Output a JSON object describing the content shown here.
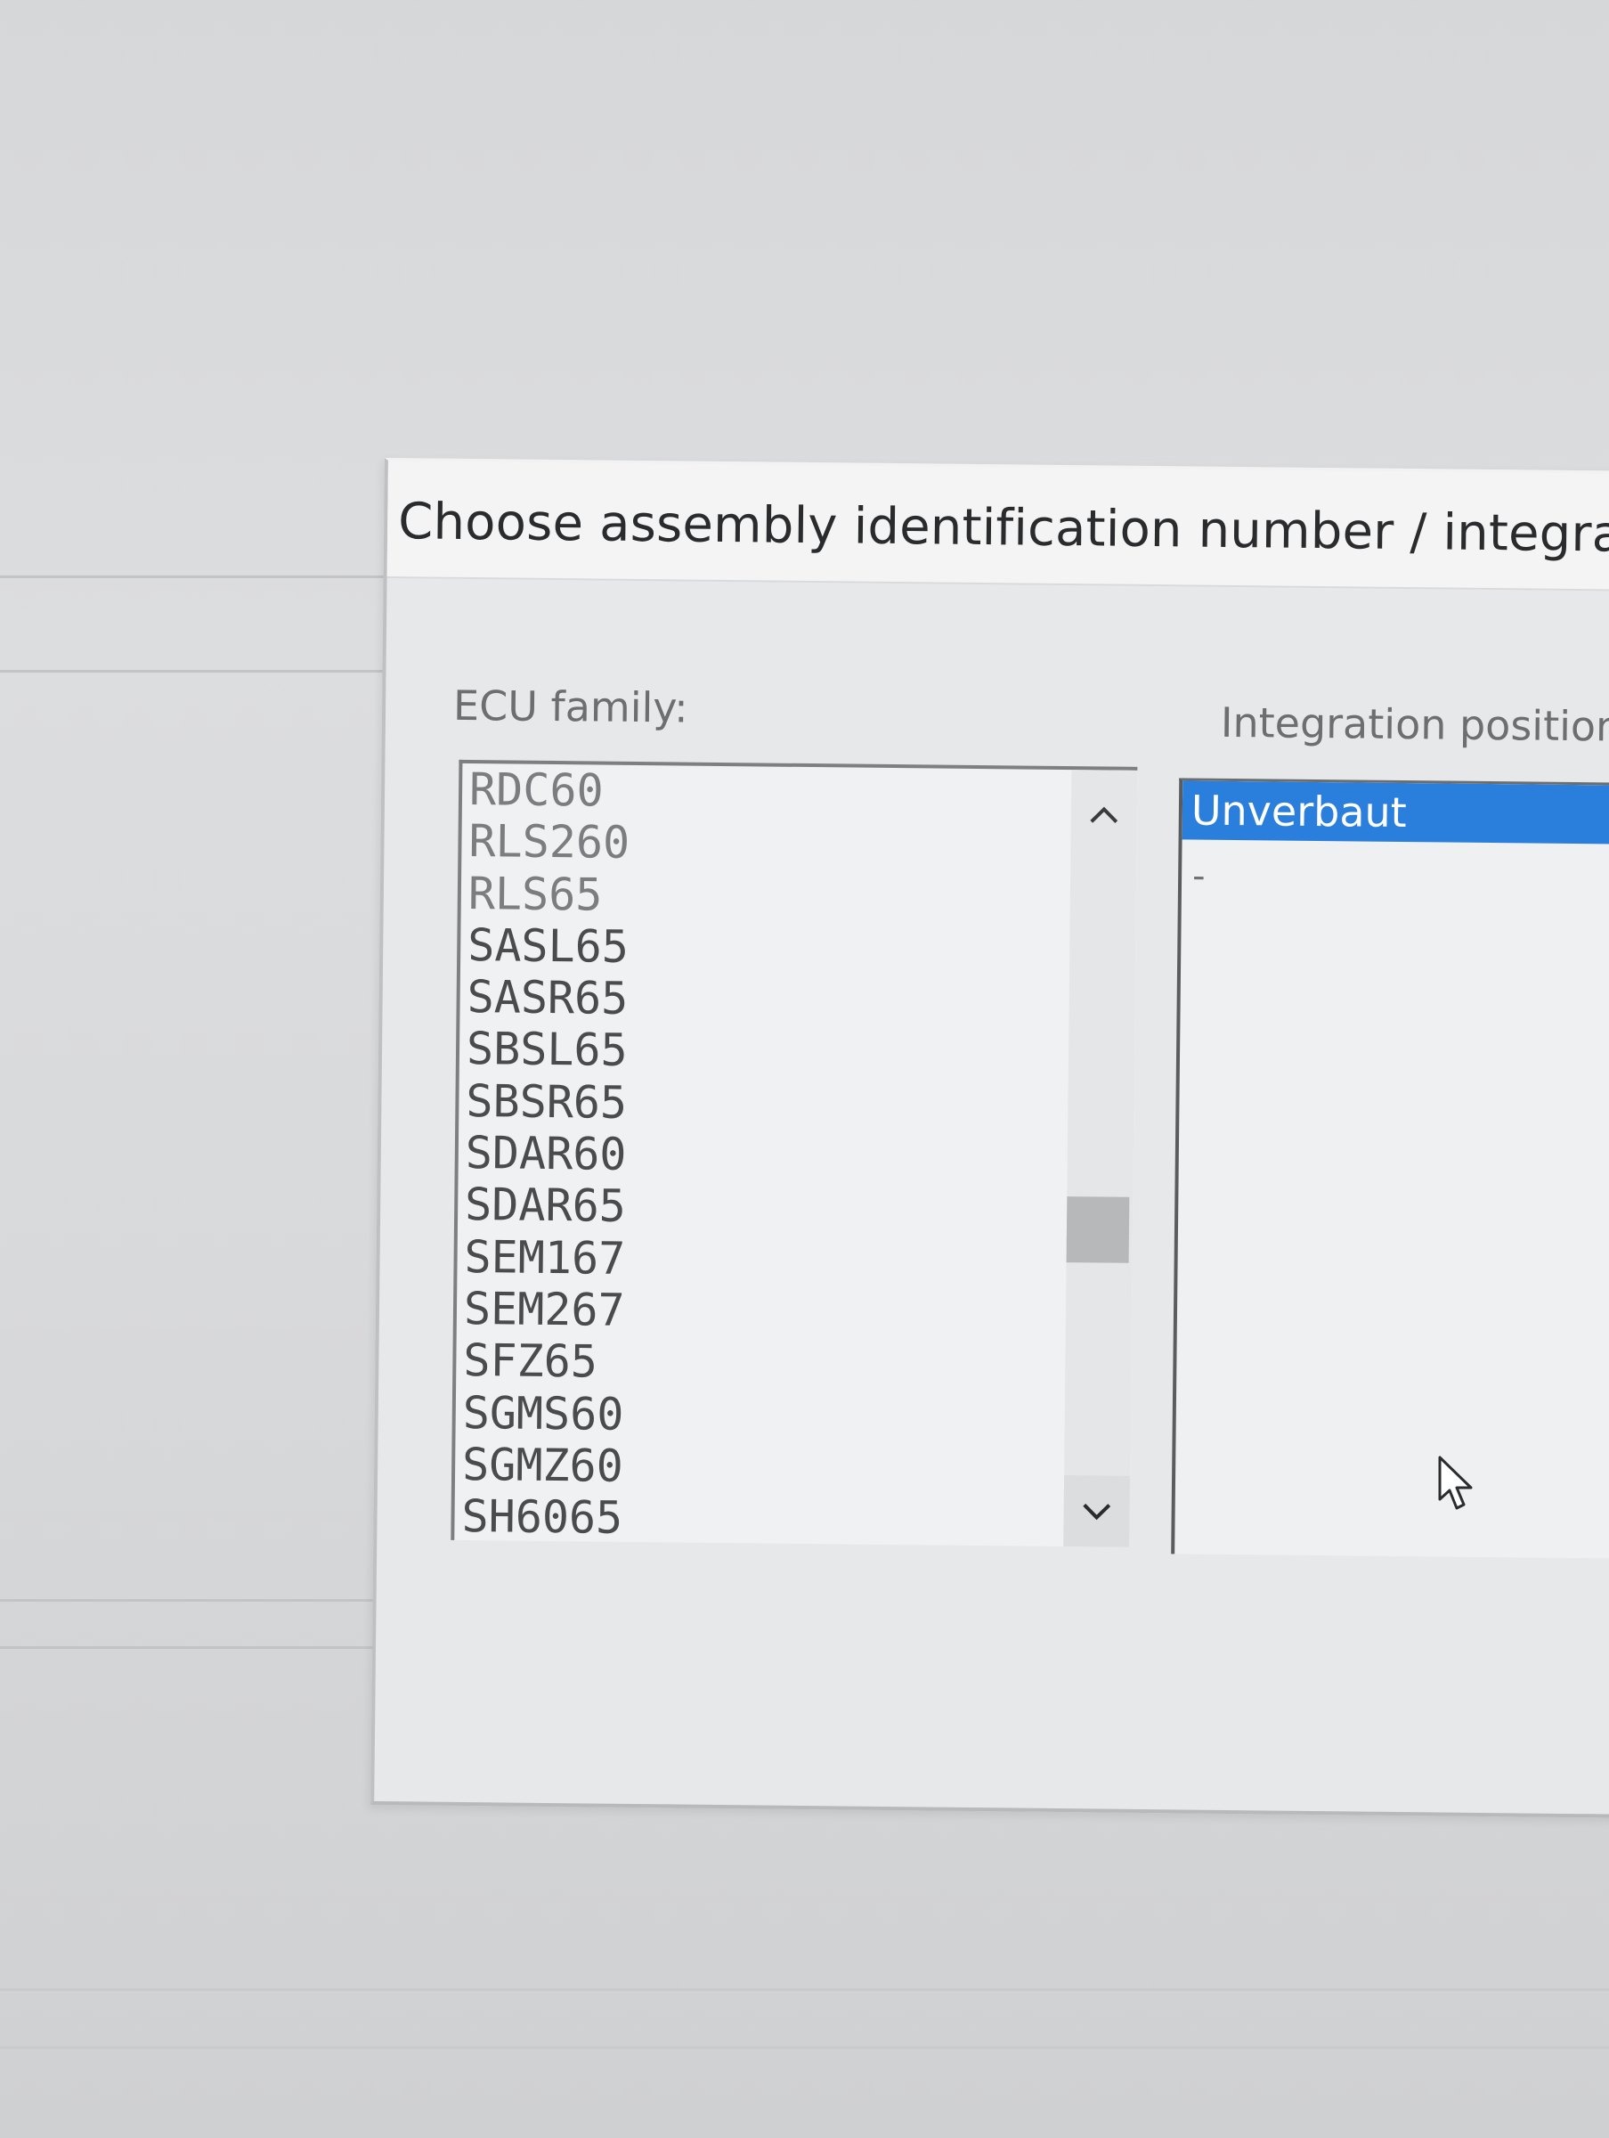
{
  "dialog": {
    "title": "Choose assembly identification number / integration p"
  },
  "ecu_family": {
    "label": "ECU family:",
    "items": [
      "RDC60",
      "RLS260",
      "RLS65",
      "SASL65",
      "SASR65",
      "SBSL65",
      "SBSR65",
      "SDAR60",
      "SDAR65",
      "SEM167",
      "SEM267",
      "SFZ65",
      "SGMS60",
      "SGMZ60",
      "SH6065"
    ],
    "scroll_position": 0.62
  },
  "integration_position": {
    "label": "Integration position:",
    "items": [
      "Unverbaut",
      "-"
    ],
    "selected_index": 0,
    "selected_color": "#2a7fdd"
  },
  "icons": {
    "scroll_up": "chevron-up-icon",
    "scroll_down": "chevron-down-icon",
    "cursor": "mouse-pointer-icon"
  }
}
